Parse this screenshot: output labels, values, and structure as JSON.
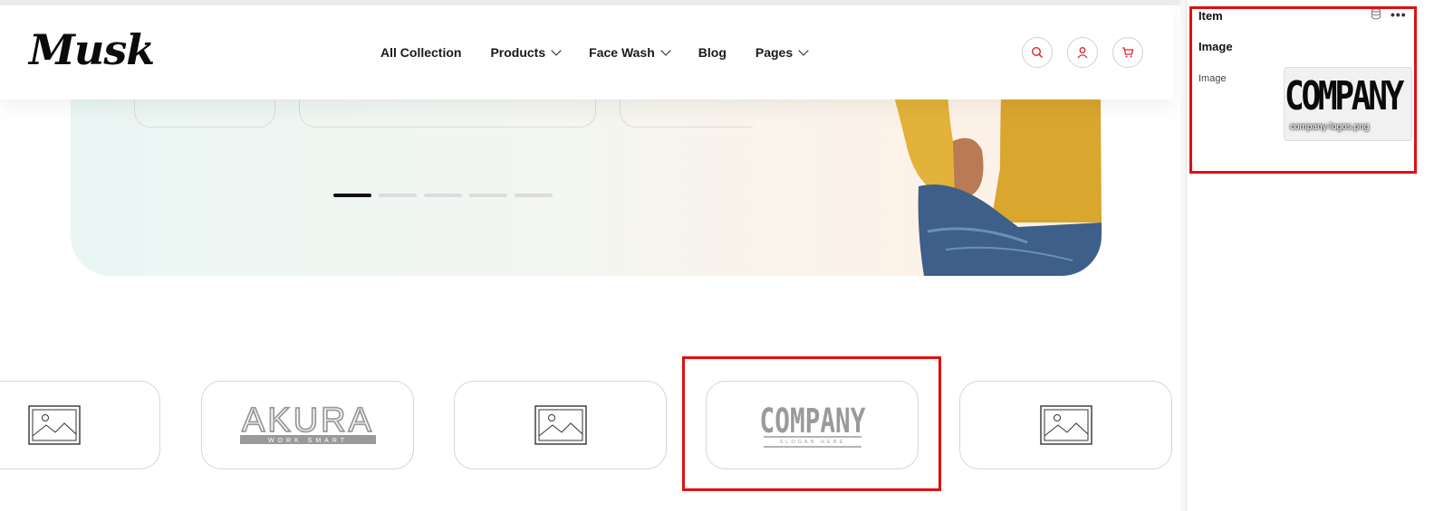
{
  "header": {
    "logo": "Musk",
    "nav": [
      {
        "label": "All Collection",
        "has_dropdown": false
      },
      {
        "label": "Products",
        "has_dropdown": true
      },
      {
        "label": "Face Wash",
        "has_dropdown": true
      },
      {
        "label": "Blog",
        "has_dropdown": false
      },
      {
        "label": "Pages",
        "has_dropdown": true
      }
    ],
    "icons": [
      "search-icon",
      "user-icon",
      "cart-icon"
    ],
    "accent_color": "#d9262b"
  },
  "hero": {
    "slider_dots": 5,
    "active_dot": 0
  },
  "logo_strip": {
    "items": [
      {
        "kind": "placeholder",
        "icon": "image-placeholder-icon"
      },
      {
        "kind": "logo",
        "title": "AKURA",
        "subtitle": "WORK SMART"
      },
      {
        "kind": "placeholder",
        "icon": "image-placeholder-icon"
      },
      {
        "kind": "logo",
        "title": "COMPANY",
        "subtitle": "SLOGAN HERE",
        "selected": true
      },
      {
        "kind": "placeholder",
        "icon": "image-placeholder-icon"
      }
    ]
  },
  "panel": {
    "title": "Item",
    "section": "Image",
    "field_label": "Image",
    "thumbnail_word": "COMPANY",
    "thumbnail_caption": "company-logos.png",
    "selection_color": "#e01010"
  }
}
